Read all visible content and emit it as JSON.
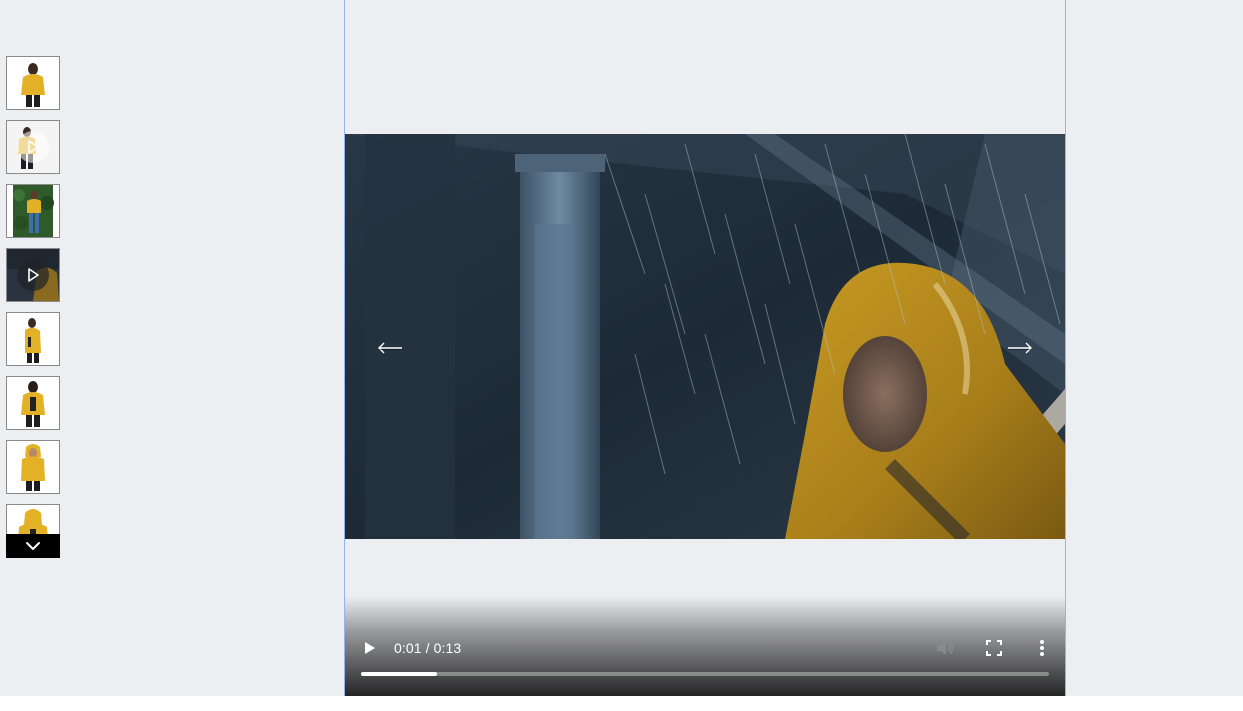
{
  "gallery": {
    "thumbnails": [
      {
        "kind": "image",
        "icon": "product-photo-front"
      },
      {
        "kind": "video",
        "icon": "play-icon"
      },
      {
        "kind": "image",
        "icon": "product-photo-lifestyle"
      },
      {
        "kind": "video",
        "icon": "play-icon"
      },
      {
        "kind": "image",
        "icon": "product-photo-side"
      },
      {
        "kind": "image",
        "icon": "product-photo-back"
      },
      {
        "kind": "image",
        "icon": "product-photo-hood"
      },
      {
        "kind": "image",
        "icon": "product-photo-detail"
      }
    ],
    "scroll_down_icon": "chevron-down-icon"
  },
  "viewer": {
    "prev_icon": "arrow-left-icon",
    "next_icon": "arrow-right-icon"
  },
  "video": {
    "time_display": "0:01 / 0:13",
    "progress": 0.11,
    "icons": {
      "play": "play-icon",
      "volume": "volume-muted-icon",
      "fullscreen": "fullscreen-icon",
      "more": "more-options-icon"
    }
  },
  "colors": {
    "background": "#eceef1",
    "viewer_border": "#8fb4f5",
    "jacket_yellow": "#e3b126"
  }
}
